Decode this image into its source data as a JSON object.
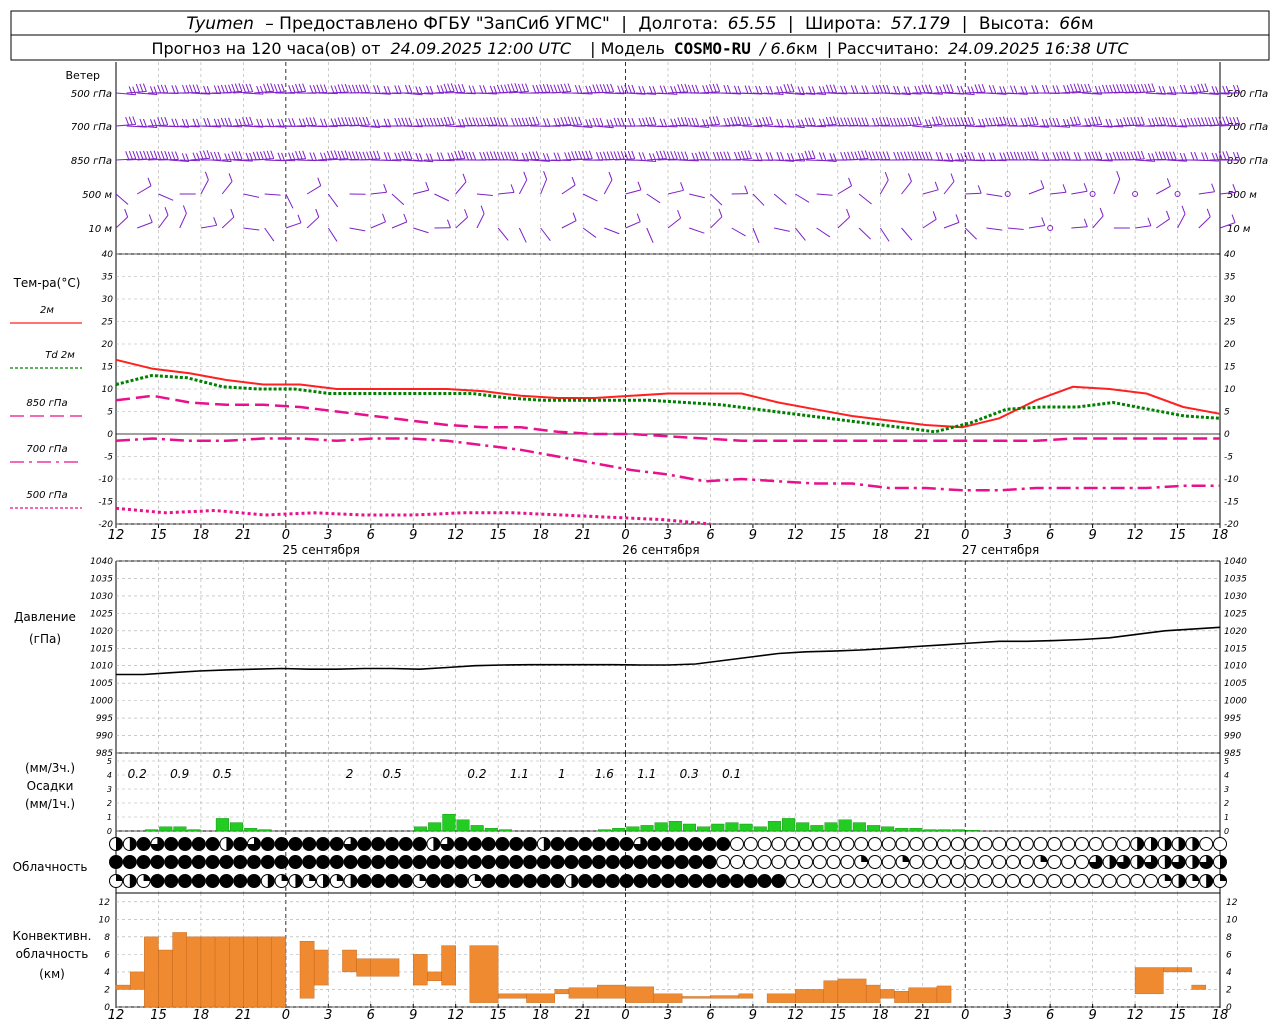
{
  "header": {
    "line1": {
      "city": "Tyumen",
      "provider": "– Предоставлено ФГБУ \"ЗапСиб УГМС\"",
      "lon_label": "Долгота:",
      "lon": "65.55",
      "lat_label": "Широта:",
      "lat": "57.179",
      "alt_label": "Высота:",
      "alt": "66",
      "alt_unit": "м"
    },
    "line2": {
      "forecast_label": "Прогноз на 120 часа(ов) от",
      "forecast_time": "24.09.2025 12:00 UTC",
      "model_label": "| Модель",
      "model": "COSMO-RU",
      "resolution": "/ 6.6",
      "resolution_unit": "км",
      "calc_label": "| Рассчитано:",
      "calc_time": "24.09.2025 16:38 UTC"
    }
  },
  "colors": {
    "wind": "#7f20c8",
    "t2m": "#ff2020",
    "td2m": "#008000",
    "t_upper": "#e8108c",
    "pressure": "#000000",
    "precip": "#22cc22",
    "convective": "#f08a30",
    "grid": "#aaaaaa"
  },
  "chart_data": [
    {
      "type": "wind_barbs",
      "title": "Ветер",
      "levels": [
        "500 гПа",
        "700 гПа",
        "850 гПа",
        "500 м",
        "10 м"
      ]
    },
    {
      "type": "line",
      "title": "Тем-ра(°C)",
      "ylim": [
        -20,
        40
      ],
      "yticks": [
        -20,
        -15,
        -10,
        -5,
        0,
        5,
        10,
        15,
        20,
        25,
        30,
        35,
        40
      ],
      "x_hours": [
        0,
        3,
        6,
        9,
        12,
        15,
        18,
        21,
        24,
        27,
        30,
        33,
        36,
        39,
        42,
        45,
        48,
        51,
        54,
        57,
        60,
        63,
        66,
        69,
        72,
        75,
        78
      ],
      "series": [
        {
          "name": "2м",
          "style": "solid",
          "values": [
            16.5,
            14.5,
            13.5,
            12,
            11,
            11,
            10,
            10,
            10,
            10,
            9.5,
            8.5,
            8,
            8,
            8.5,
            9,
            9,
            9,
            7,
            5.5,
            4,
            3,
            2,
            1.5,
            3.5,
            7.5,
            10.5,
            10,
            9,
            6,
            4.5
          ]
        },
        {
          "name": "Td 2м",
          "style": "dotted",
          "values": [
            11,
            13,
            12.5,
            10.5,
            10,
            10,
            9,
            9,
            9,
            9,
            9,
            8,
            7.5,
            7.5,
            7.5,
            7.5,
            7,
            6.5,
            5.5,
            4.5,
            3.5,
            2.5,
            1.5,
            0.5,
            2.5,
            5.5,
            6,
            6,
            7,
            5.5,
            4,
            3.5
          ]
        },
        {
          "name": "850 гПа",
          "style": "dash",
          "values": [
            7.5,
            8.5,
            7,
            6.5,
            6.5,
            6,
            5,
            4,
            3,
            2,
            1.5,
            1.5,
            0.5,
            0,
            0,
            -0.5,
            -1,
            -1.5,
            -1.5,
            -1.5,
            -1.5,
            -1.5,
            -1.5,
            -1.5,
            -1.5,
            -1.5,
            -1,
            -1,
            -1,
            -1,
            -1
          ]
        },
        {
          "name": "700 гПа",
          "style": "dashdot",
          "values": [
            -1.5,
            -1,
            -1.5,
            -1.5,
            -1,
            -1,
            -1.5,
            -1,
            -1,
            -1.5,
            -2.5,
            -3.5,
            -5,
            -6.5,
            -8,
            -9,
            -10.5,
            -10,
            -10.5,
            -11,
            -11,
            -12,
            -12,
            -12.5,
            -12.5,
            -12,
            -12,
            -12,
            -12,
            -11.5,
            -11.5
          ]
        },
        {
          "name": "500 гПа",
          "style": "dotted",
          "values": [
            -16.5,
            -17.5,
            -17,
            -18,
            -17.5,
            -18,
            -18,
            -17.5,
            -17.5,
            -18,
            -18.5,
            -19,
            -20
          ]
        }
      ],
      "xticks": [
        "12",
        "15",
        "18",
        "21",
        "0",
        "3",
        "6",
        "9",
        "12",
        "15",
        "18",
        "21",
        "0",
        "3",
        "6",
        "9",
        "12",
        "15",
        "18",
        "21",
        "0",
        "3",
        "6",
        "9",
        "12",
        "15",
        "18"
      ],
      "dates": [
        "25 сентября",
        "26 сентября",
        "27 сентября"
      ]
    },
    {
      "type": "line",
      "title": "Давление",
      "unit": "(гПа)",
      "ylim": [
        985,
        1040
      ],
      "yticks": [
        985,
        990,
        995,
        1000,
        1005,
        1010,
        1015,
        1020,
        1025,
        1030,
        1035,
        1040
      ],
      "values": [
        1007.5,
        1007.5,
        1008,
        1008.5,
        1008.8,
        1009,
        1009.2,
        1009,
        1009,
        1009.2,
        1009.2,
        1009,
        1009.5,
        1010,
        1010.2,
        1010.3,
        1010.3,
        1010.3,
        1010.3,
        1010.2,
        1010.2,
        1010.5,
        1011.5,
        1012.5,
        1013.5,
        1014,
        1014.2,
        1014.5,
        1015,
        1015.5,
        1016,
        1016.5,
        1017,
        1017,
        1017.2,
        1017.5,
        1018,
        1019,
        1020,
        1020.5,
        1021
      ]
    },
    {
      "type": "bar",
      "title": "Осадки",
      "units": [
        "(мм/3ч.)",
        "(мм/1ч.)"
      ],
      "ylim": [
        0,
        5
      ],
      "yticks": [
        0,
        1,
        2,
        3,
        4,
        5
      ],
      "totals": [
        {
          "hour": 1.5,
          "label": "0.2"
        },
        {
          "hour": 4.5,
          "label": "0.9"
        },
        {
          "hour": 7.5,
          "label": "0.5"
        },
        {
          "hour": 16.5,
          "label": "2"
        },
        {
          "hour": 19.5,
          "label": "0.5"
        },
        {
          "hour": 25.5,
          "label": "0.2"
        },
        {
          "hour": 28.5,
          "label": "1.1"
        },
        {
          "hour": 31.5,
          "label": "1"
        },
        {
          "hour": 34.5,
          "label": "1.6"
        },
        {
          "hour": 37.5,
          "label": "1.1"
        },
        {
          "hour": 40.5,
          "label": "0.3"
        },
        {
          "hour": 43.5,
          "label": "0.1"
        }
      ],
      "hourly": [
        0,
        0,
        0.1,
        0.3,
        0.3,
        0.1,
        0,
        0.9,
        0.6,
        0.2,
        0.1,
        0,
        0,
        0,
        0,
        0,
        0,
        0,
        0,
        0,
        0,
        0.3,
        0.6,
        1.2,
        0.8,
        0.4,
        0.2,
        0.1,
        0,
        0,
        0,
        0,
        0,
        0,
        0.1,
        0.2,
        0.3,
        0.4,
        0.6,
        0.7,
        0.5,
        0.3,
        0.5,
        0.6,
        0.5,
        0.3,
        0.7,
        0.9,
        0.6,
        0.4,
        0.6,
        0.8,
        0.6,
        0.4,
        0.3,
        0.2,
        0.2,
        0.1,
        0.1,
        0.1,
        0.05,
        0,
        0
      ]
    },
    {
      "type": "cloud_symbols",
      "title": "Облачность",
      "rows": 3,
      "count": 81
    },
    {
      "type": "bar_range",
      "title": "Конвективн. облачность",
      "unit": "(км)",
      "ylim": [
        0,
        13
      ],
      "yticks": [
        0,
        2,
        4,
        6,
        8,
        10,
        12
      ]
    }
  ]
}
